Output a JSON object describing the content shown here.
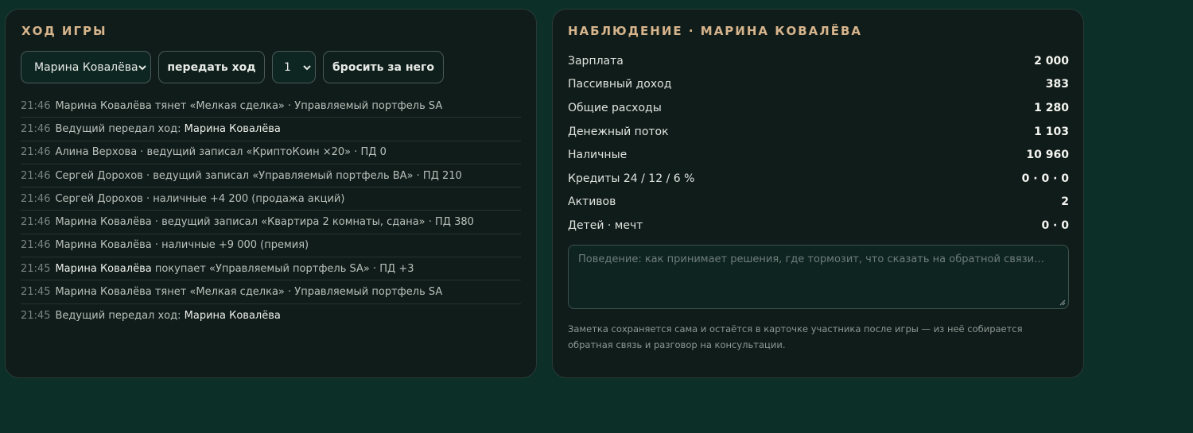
{
  "game_log": {
    "title": "Ход игры",
    "player_select_value": "Марина Ковалёва",
    "pass_turn_label": "передать ход",
    "dice_value": "1",
    "roll_for_label": "бросить за него",
    "entries": [
      {
        "time": "21:46",
        "strong": "",
        "text": "Марина Ковалёва тянет «Мелкая сделка» · Управляемый портфель SA"
      },
      {
        "time": "21:46",
        "strong": "Марина Ковалёва",
        "text": "Ведущий передал ход: "
      },
      {
        "time": "21:46",
        "strong": "",
        "text": "Алина Верхова · ведущий записал «КриптоКоин ×20» · ПД 0"
      },
      {
        "time": "21:46",
        "strong": "",
        "text": "Сергей Дорохов · ведущий записал «Управляемый портфель BA» · ПД 210"
      },
      {
        "time": "21:46",
        "strong": "",
        "text": "Сергей Дорохов · наличные +4 200 (продажа акций)"
      },
      {
        "time": "21:46",
        "strong": "",
        "text": "Марина Ковалёва · ведущий записал «Квартира 2 комнаты, сдана» · ПД 380"
      },
      {
        "time": "21:46",
        "strong": "",
        "text": "Марина Ковалёва · наличные +9 000 (премия)"
      },
      {
        "time": "21:45",
        "strong_first": "Марина Ковалёва",
        "text": " покупает «Управляемый портфель SA» · ПД +3"
      },
      {
        "time": "21:45",
        "strong": "",
        "text": "Марина Ковалёва тянет «Мелкая сделка» · Управляемый портфель SA"
      },
      {
        "time": "21:45",
        "strong": "Марина Ковалёва",
        "text": "Ведущий передал ход: "
      }
    ]
  },
  "observation": {
    "title": "Наблюдение · Марина Ковалёва",
    "stats": [
      {
        "label": "Зарплата",
        "value": "2 000"
      },
      {
        "label": "Пассивный доход",
        "value": "383"
      },
      {
        "label": "Общие расходы",
        "value": "1 280"
      },
      {
        "label": "Денежный поток",
        "value": "1 103"
      },
      {
        "label": "Наличные",
        "value": "10 960"
      },
      {
        "label": "Кредиты 24 / 12 / 6 %",
        "value": "0 · 0 · 0"
      },
      {
        "label": "Активов",
        "value": "2"
      },
      {
        "label": "Детей · мечт",
        "value": "0 · 0"
      }
    ],
    "notes_placeholder": "Поведение: как принимает решения, где тормозит, что сказать на обратной связи…",
    "hint": "Заметка сохраняется сама и остаётся в карточке участника после игры — из неё собирается обратная связь и разговор на консультации."
  },
  "colors": {
    "background": "#0c3028",
    "card": "#101c19",
    "accent_title": "#d6b48c"
  },
  "icons": [
    "chevron-down-icon",
    "resize-grip-icon"
  ]
}
